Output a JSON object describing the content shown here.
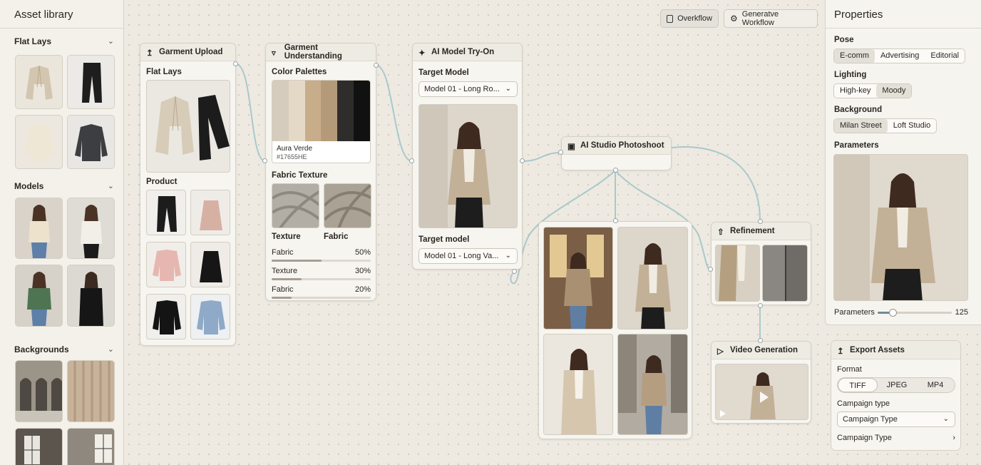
{
  "library": {
    "title": "Asset library",
    "sections": [
      {
        "label": "Flat Lays"
      },
      {
        "label": "Models"
      },
      {
        "label": "Backgrounds"
      }
    ]
  },
  "topbar": {
    "overflow": "Overkflow",
    "workflow": "Generatve Workflow"
  },
  "garment_upload": {
    "title": "Garment Upload",
    "flat_lays": "Flat Lays",
    "product": "Product"
  },
  "garment_understanding": {
    "title": "Garment Understanding",
    "color_palettes": "Color Palettes",
    "swatch_name": "Aura Verde",
    "swatch_code": "#17655HE",
    "swatch_colors": [
      "#d6ccbd",
      "#e4d9c6",
      "#c8ad8a",
      "#b59a7a",
      "#2f2d2c",
      "#111111"
    ],
    "fabric_texture": "Fabric Texture",
    "texture_labels": [
      "Texture",
      "Fabric"
    ],
    "bars": [
      {
        "label": "Fabric",
        "value": "50%",
        "fill": 0.5
      },
      {
        "label": "Texture",
        "value": "30%",
        "fill": 0.3
      },
      {
        "label": "Fabric",
        "value": "20%",
        "fill": 0.2
      }
    ]
  },
  "try_on": {
    "title": "AI Model Try-On",
    "target_model_label": "Target Model",
    "target_model_value": "Model 01 - Long Ro...",
    "target_model2_label": "Target model",
    "target_model2_value": "Model 01 - Long Va..."
  },
  "photoshoot": {
    "title": "AI Studio Photoshoot"
  },
  "refinement": {
    "title": "Refinement"
  },
  "video": {
    "title": "Video Generation"
  },
  "properties": {
    "title": "Properties",
    "pose_label": "Pose",
    "pose_options": [
      "E-comm",
      "Advertising",
      "Editorial"
    ],
    "lighting_label": "Lighting",
    "lighting_options": [
      "High-key",
      "Moody"
    ],
    "background_label": "Background",
    "background_options": [
      "Milan Street",
      "Loft Studio"
    ],
    "parameters_label": "Parameters",
    "slider_label": "Parameters",
    "slider_value": "125",
    "slider_fill": 0.2
  },
  "export": {
    "title": "Export Assets",
    "format_label": "Format",
    "formats": [
      "TIFF",
      "JPEG",
      "MP4"
    ],
    "campaign_type_label": "Campaign type",
    "campaign_type_value": "Campaign Type",
    "campaign_row": "Campaign Type"
  }
}
